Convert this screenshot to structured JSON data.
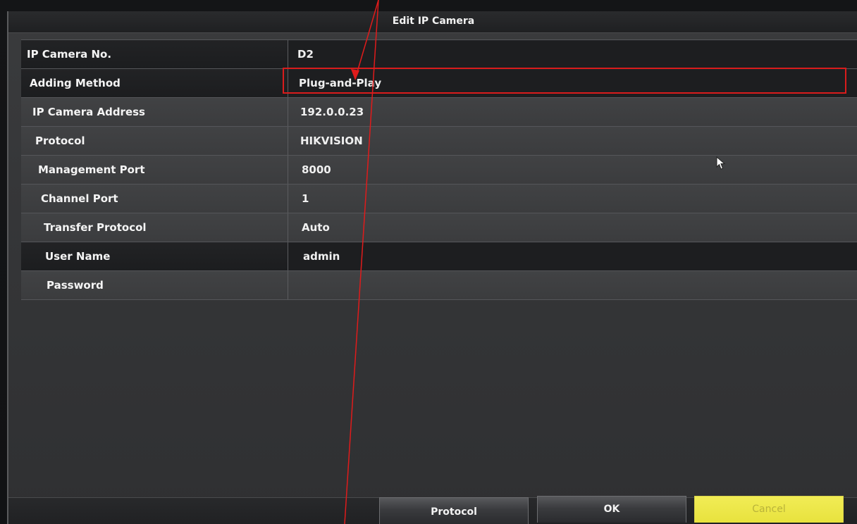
{
  "dialog": {
    "title": "Edit IP Camera"
  },
  "fields": [
    {
      "label": "IP Camera No.",
      "value": "D2"
    },
    {
      "label": "Adding Method",
      "value": "Plug-and-Play"
    },
    {
      "label": "IP Camera Address",
      "value": "192.0.0.23"
    },
    {
      "label": "Protocol",
      "value": "HIKVISION"
    },
    {
      "label": "Management Port",
      "value": "8000"
    },
    {
      "label": "Channel Port",
      "value": "1"
    },
    {
      "label": "Transfer Protocol",
      "value": "Auto"
    },
    {
      "label": "User Name",
      "value": "admin"
    },
    {
      "label": "Password",
      "value": ""
    }
  ],
  "buttons": {
    "protocol": "Protocol",
    "ok": "OK",
    "cancel": "Cancel"
  },
  "colors": {
    "highlight": "#d91c1c",
    "cancel_bg": "#e8e23e"
  }
}
